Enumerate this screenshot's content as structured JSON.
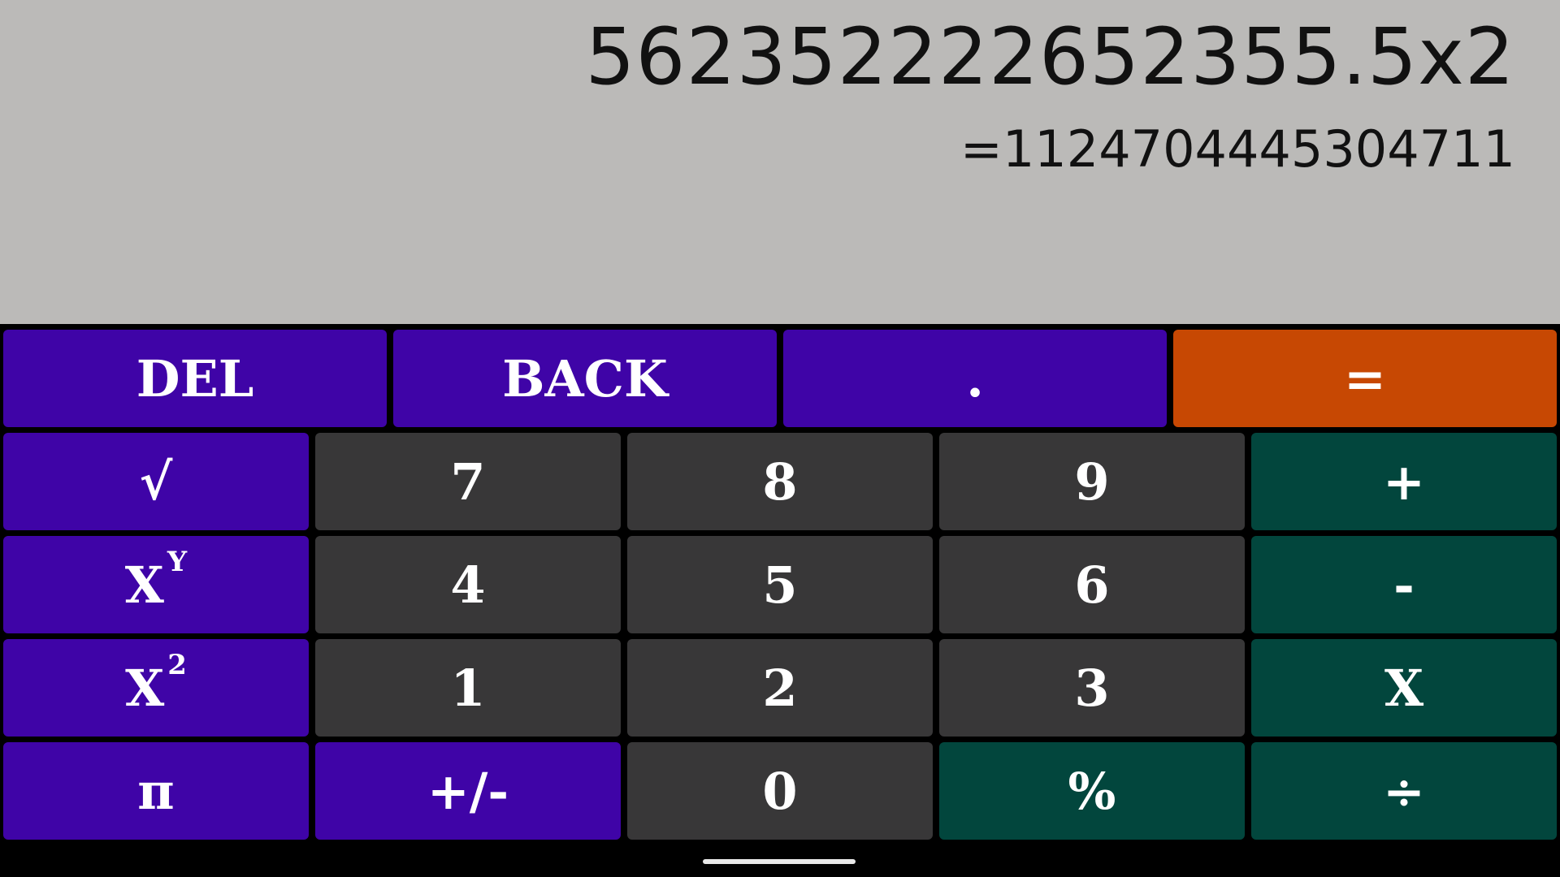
{
  "display": {
    "expression": "562352222652355.5x2",
    "result": "=1124704445304711"
  },
  "keys": {
    "del": "DEL",
    "back": "BACK",
    "dot": ".",
    "equals": "=",
    "sqrt": "√",
    "seven": "7",
    "eight": "8",
    "nine": "9",
    "plus": "+",
    "power_base": "X",
    "power_exp": "Y",
    "four": "4",
    "five": "5",
    "six": "6",
    "minus": "-",
    "square_base": "X",
    "square_exp": "2",
    "one": "1",
    "two": "2",
    "three": "3",
    "multiply": "X",
    "pi": "π",
    "plus_minus": "+/-",
    "zero": "0",
    "percent": "%",
    "divide": "÷"
  },
  "colors": {
    "display_bg": "#bbbab8",
    "function_key": "#3f04a7",
    "equals_key": "#c74803",
    "digit_key": "#383738",
    "operator_key": "#02463d"
  }
}
